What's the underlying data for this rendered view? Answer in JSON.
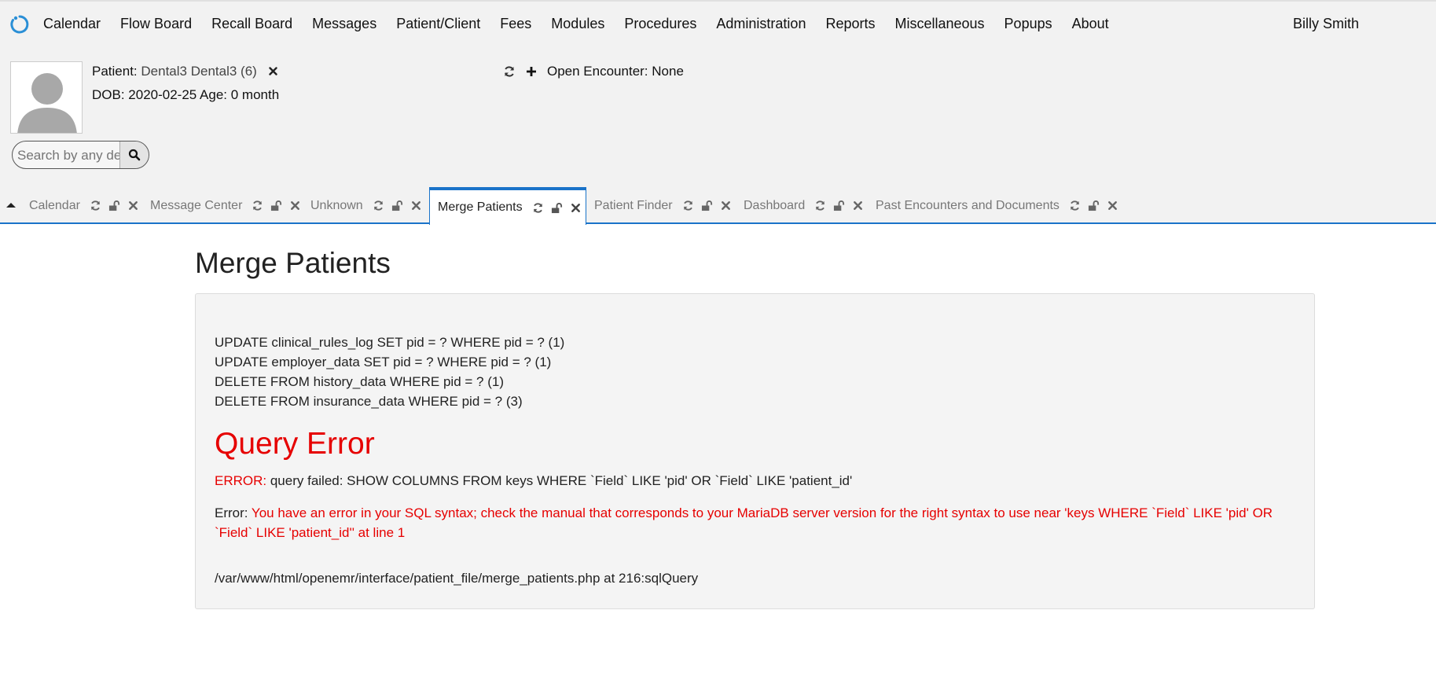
{
  "menu": {
    "items": [
      "Calendar",
      "Flow Board",
      "Recall Board",
      "Messages",
      "Patient/Client",
      "Fees",
      "Modules",
      "Procedures",
      "Administration",
      "Reports",
      "Miscellaneous",
      "Popups",
      "About"
    ],
    "user": "Billy Smith"
  },
  "patient": {
    "label": "Patient:",
    "name": "Dental3 Dental3 (6)",
    "dob_line": "DOB: 2020-02-25 Age: 0 month"
  },
  "encounter": {
    "text": "Open Encounter: None"
  },
  "search": {
    "placeholder": "Search by any demographics"
  },
  "tabs": [
    {
      "label": "Calendar",
      "active": false
    },
    {
      "label": "Message Center",
      "active": false
    },
    {
      "label": "Unknown",
      "active": false
    },
    {
      "label": "Merge Patients",
      "active": true
    },
    {
      "label": "Patient Finder",
      "active": false
    },
    {
      "label": "Dashboard",
      "active": false
    },
    {
      "label": "Past Encounters and Documents",
      "active": false
    }
  ],
  "main": {
    "title": "Merge Patients",
    "sql_lines": [
      "UPDATE clinical_rules_log SET pid = ? WHERE pid = ? (1)",
      "UPDATE employer_data SET pid = ? WHERE pid = ? (1)",
      "DELETE FROM history_data WHERE pid = ? (1)",
      "DELETE FROM insurance_data WHERE pid = ? (3)"
    ],
    "error_title": "Query Error",
    "error_label": "ERROR:",
    "error_query": " query failed: SHOW COLUMNS FROM keys WHERE `Field` LIKE 'pid' OR `Field` LIKE 'patient_id'",
    "error2_label": "Error: ",
    "error2_msg": "You have an error in your SQL syntax; check the manual that corresponds to your MariaDB server version for the right syntax to use near 'keys WHERE `Field` LIKE 'pid' OR `Field` LIKE 'patient_id'' at line 1",
    "path": "/var/www/html/openemr/interface/patient_file/merge_patients.php at 216:sqlQuery"
  },
  "colors": {
    "accent": "#1a73c9",
    "error": "#e60000",
    "header_bg": "#f2f2f2"
  }
}
